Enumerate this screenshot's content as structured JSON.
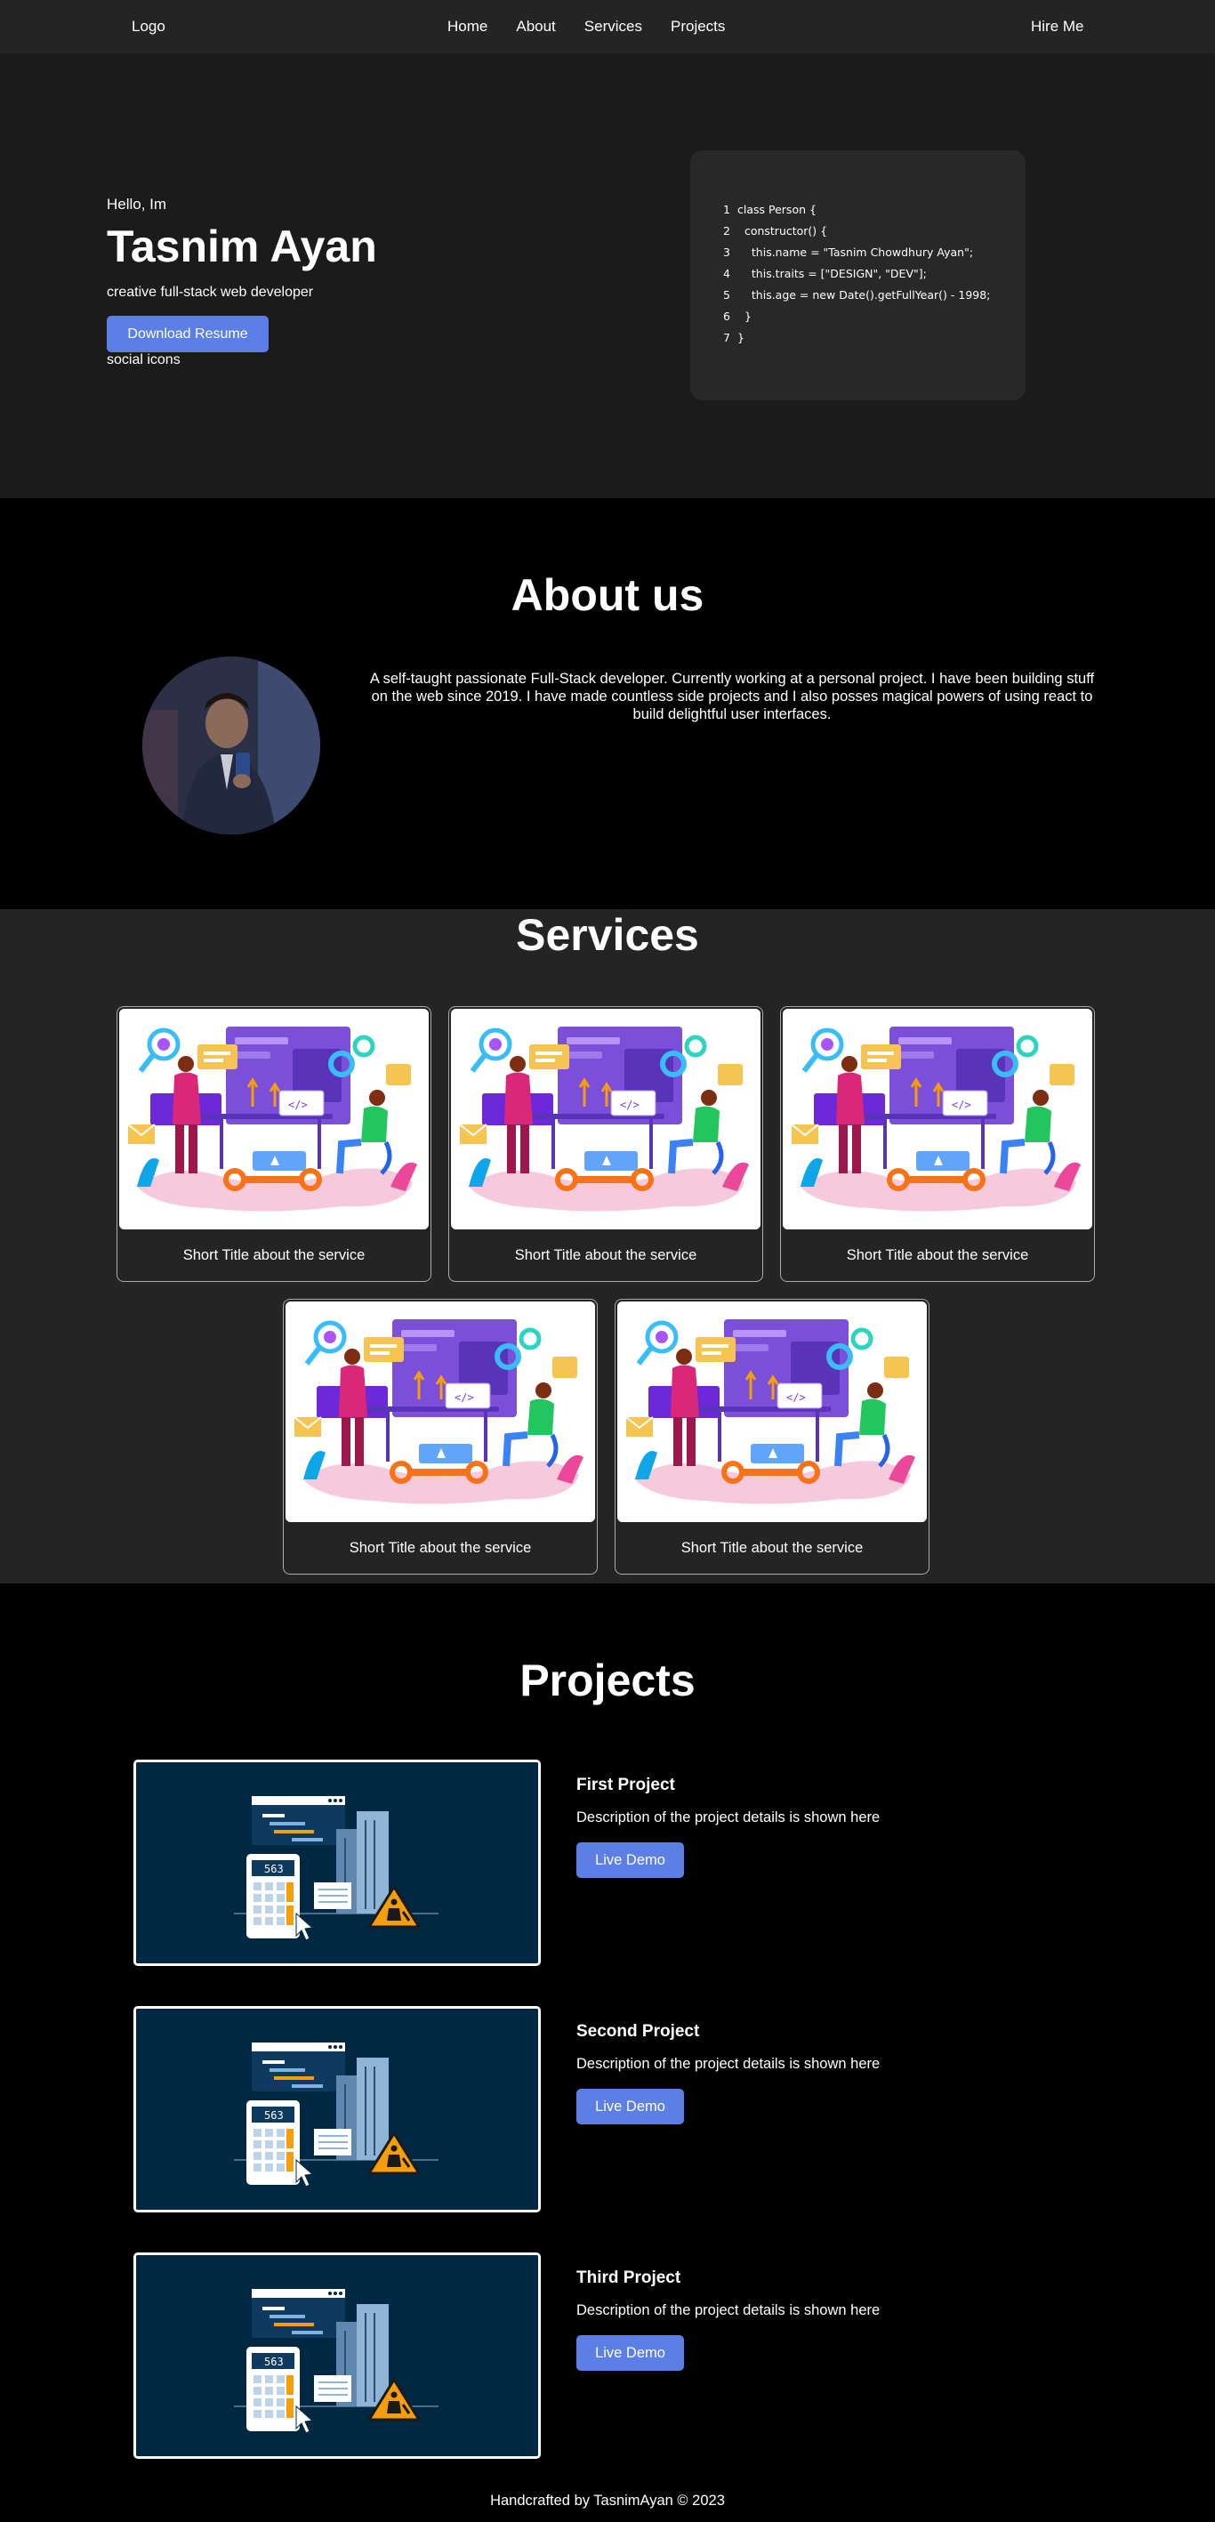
{
  "nav": {
    "logo": "Logo",
    "links": [
      "Home",
      "About",
      "Services",
      "Projects"
    ],
    "hire": "Hire Me"
  },
  "hero": {
    "greeting": "Hello, Im",
    "name": "Tasnim Ayan",
    "tagline": "creative full-stack web developer",
    "download_label": "Download Resume",
    "social": "social icons",
    "code_lines": [
      {
        "n": "1",
        "text": "class Person {"
      },
      {
        "n": "2",
        "text": "  constructor() {"
      },
      {
        "n": "3",
        "text": "    this.name = \"Tasnim Chowdhury Ayan\";"
      },
      {
        "n": "4",
        "text": "    this.traits = [\"DESIGN\", \"DEV\"];"
      },
      {
        "n": "5",
        "text": "    this.age = new Date().getFullYear() - 1998;"
      },
      {
        "n": "6",
        "text": "  }"
      },
      {
        "n": "7",
        "text": "}"
      }
    ]
  },
  "about": {
    "heading": "About us",
    "description": "A self-taught passionate Full-Stack developer. Currently working at a personal project. I have been building stuff on the web since 2019. I have made countless side projects and I also posses magical powers of using react to build delightful user interfaces."
  },
  "services": {
    "heading": "Services",
    "cards": [
      {
        "title": "Short Title about the service"
      },
      {
        "title": "Short Title about the service"
      },
      {
        "title": "Short Title about the service"
      },
      {
        "title": "Short Title about the service"
      },
      {
        "title": "Short Title about the service"
      }
    ]
  },
  "projects": {
    "heading": "Projects",
    "items": [
      {
        "title": "First Project",
        "description": "Description of the project details is shown here",
        "demo": "Live Demo",
        "counter": "563"
      },
      {
        "title": "Second Project",
        "description": "Description of the project details is shown here",
        "demo": "Live Demo",
        "counter": "563"
      },
      {
        "title": "Third Project",
        "description": "Description of the project details is shown here",
        "demo": "Live Demo",
        "counter": "563"
      }
    ]
  },
  "footer": {
    "text": "Handcrafted by TasnimAyan © 2023"
  },
  "colors": {
    "accent": "#5c7fe6",
    "nav_bg": "#242424",
    "hero_bg": "#1b1b1b",
    "project_bg": "#012843"
  }
}
